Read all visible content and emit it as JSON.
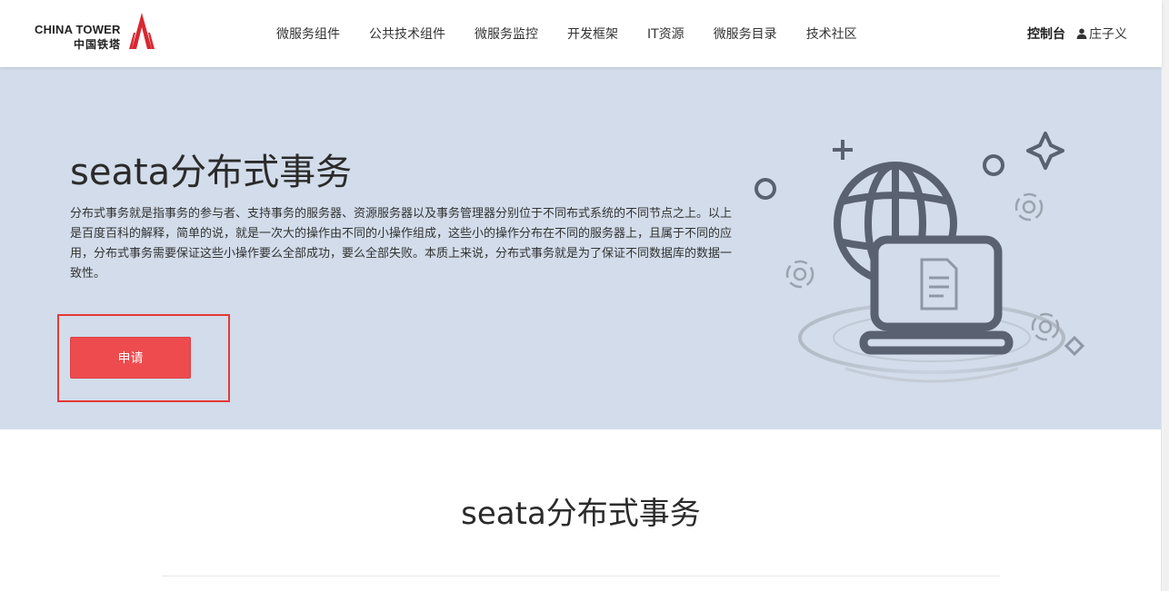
{
  "header": {
    "logo_en": "CHINA TOWER",
    "logo_cn": "中国铁塔",
    "nav": [
      {
        "label": "微服务组件"
      },
      {
        "label": "公共技术组件"
      },
      {
        "label": "微服务监控"
      },
      {
        "label": "开发框架"
      },
      {
        "label": "IT资源"
      },
      {
        "label": "微服务目录"
      },
      {
        "label": "技术社区"
      }
    ],
    "console_label": "控制台",
    "user_name": "庄子义"
  },
  "hero": {
    "title": "seata分布式事务",
    "description": "分布式事务就是指事务的参与者、支持事务的服务器、资源服务器以及事务管理器分别位于不同布式系统的不同节点之上。以上是百度百科的解释，简单的说，就是一次大的操作由不同的小操作组成，这些小的操作分布在不同的服务器上，且属于不同的应用，分布式事务需要保证这些小操作要么全部成功，要么全部失败。本质上来说，分布式事务就是为了保证不同数据库的数据一致性。",
    "apply_label": "申请",
    "illustration_icon": "globe-laptop-document-illustration"
  },
  "section": {
    "title": "seata分布式事务"
  },
  "colors": {
    "hero_bg": "#d2dcea",
    "accent_red": "#ee4b4f",
    "highlight_border": "#e53935",
    "icon_gray": "#5a6170"
  }
}
